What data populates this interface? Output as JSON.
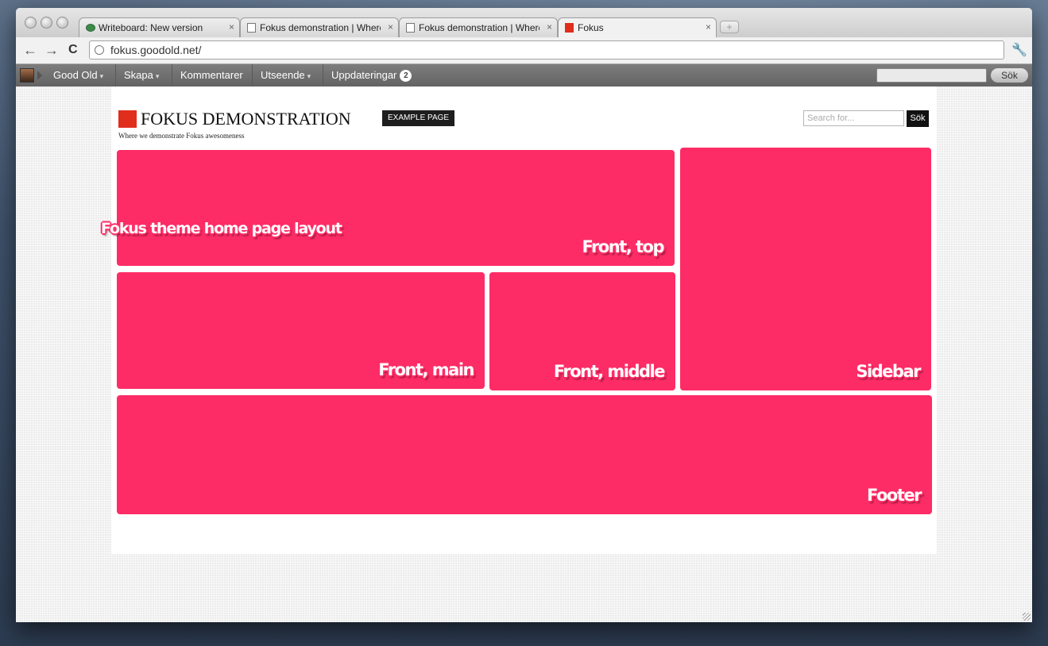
{
  "browser": {
    "tabs": [
      {
        "title": "Writeboard: New version",
        "icon": "writeboard-icon",
        "active": false
      },
      {
        "title": "Fokus demonstration | Where we demonstrate Fokus awesomeness",
        "icon": "document-icon",
        "active": false
      },
      {
        "title": "Fokus demonstration | Where we demonstrate Fokus awesomeness",
        "icon": "document-icon",
        "active": false
      },
      {
        "title": "Fokus",
        "icon": "fokus-icon",
        "active": true
      }
    ],
    "close_glyph": "×",
    "new_tab_glyph": "+",
    "back_glyph": "←",
    "forward_glyph": "→",
    "reload_glyph": "C",
    "wrench_glyph": "🔧",
    "url": "fokus.goodold.net/"
  },
  "adminbar": {
    "menu": [
      {
        "label": "Good Old",
        "dropdown": true
      },
      {
        "label": "Skapa",
        "dropdown": true
      },
      {
        "label": "Kommentarer",
        "dropdown": false
      },
      {
        "label": "Utseende",
        "dropdown": true
      },
      {
        "label": "Uppdateringar",
        "dropdown": false,
        "badge": "2"
      }
    ],
    "caret": "▾",
    "search_value": "",
    "search_button": "Sök"
  },
  "site": {
    "title": "FOKUS DEMONSTRATION",
    "nav_page": "EXAMPLE PAGE",
    "tagline": "Where we demonstrate Fokus awesomeness",
    "search_placeholder": "Search for...",
    "search_button": "Sök"
  },
  "annotation": "Fokus theme home page layout",
  "regions": {
    "front_top": "Front, top",
    "front_main": "Front, main",
    "front_middle": "Front, middle",
    "sidebar": "Sidebar",
    "footer": "Footer"
  },
  "colors": {
    "region": "#fe2c66",
    "logo": "#e02d1c",
    "adminbar": "#6e6e6e"
  }
}
